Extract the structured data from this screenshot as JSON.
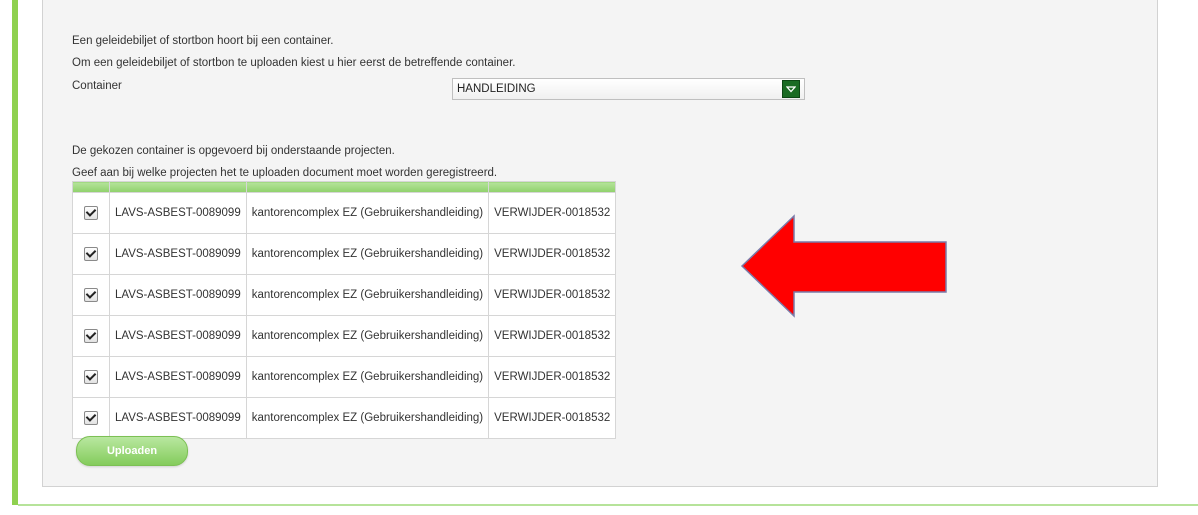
{
  "intro": {
    "line1": "Een geleidebiljet of stortbon hoort bij een container.",
    "line2": "Om een geleidebiljet of stortbon te uploaden kiest u hier eerst de betreffende container."
  },
  "container": {
    "label": "Container",
    "selected": "HANDLEIDING"
  },
  "projects_info": {
    "line1": "De gekozen container is opgevoerd bij onderstaande projecten.",
    "line2": "Geef aan bij welke projecten het te uploaden document moet worden geregistreerd."
  },
  "table": {
    "rows": [
      {
        "checked": true,
        "lavs": "LAVS-ASBEST-0089099",
        "project": "kantorencomplex EZ (Gebruikershandleiding)",
        "code": "VERWIJDER-0018532"
      },
      {
        "checked": true,
        "lavs": "LAVS-ASBEST-0089099",
        "project": "kantorencomplex EZ (Gebruikershandleiding)",
        "code": "VERWIJDER-0018532"
      },
      {
        "checked": true,
        "lavs": "LAVS-ASBEST-0089099",
        "project": "kantorencomplex EZ (Gebruikershandleiding)",
        "code": "VERWIJDER-0018532"
      },
      {
        "checked": true,
        "lavs": "LAVS-ASBEST-0089099",
        "project": "kantorencomplex EZ (Gebruikershandleiding)",
        "code": "VERWIJDER-0018532"
      },
      {
        "checked": true,
        "lavs": "LAVS-ASBEST-0089099",
        "project": "kantorencomplex EZ (Gebruikershandleiding)",
        "code": "VERWIJDER-0018532"
      },
      {
        "checked": true,
        "lavs": "LAVS-ASBEST-0089099",
        "project": "kantorencomplex EZ (Gebruikershandleiding)",
        "code": "VERWIJDER-0018532"
      }
    ]
  },
  "upload_button": {
    "label": "Uploaden"
  },
  "icons": {
    "select": "chevron-down-icon",
    "annotation": "arrow-left-icon"
  },
  "colors": {
    "accent": "#8fd14f",
    "select_button": "#1a6b23",
    "arrow": "#ff0000"
  }
}
